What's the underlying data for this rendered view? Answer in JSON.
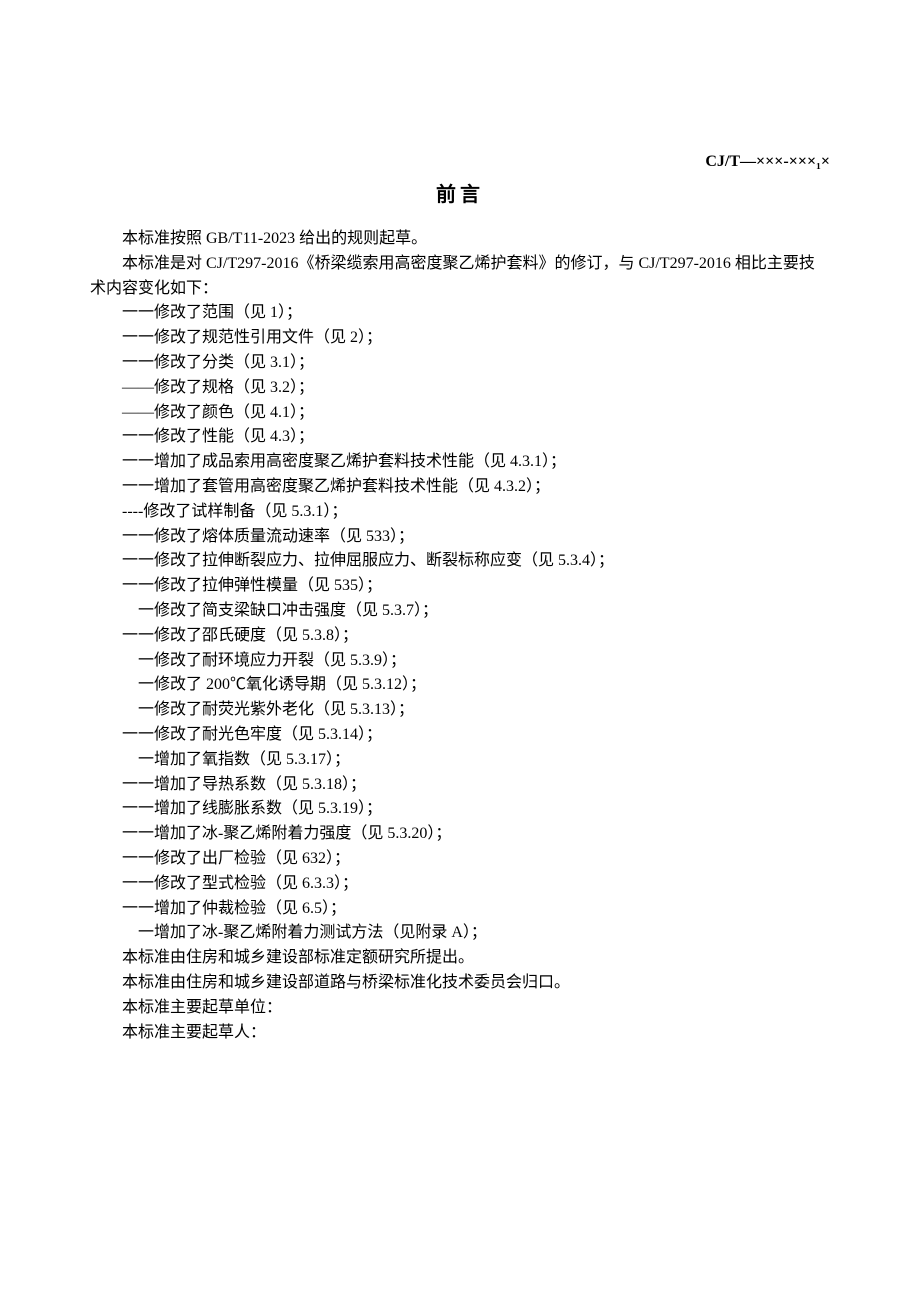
{
  "header_id": "CJ/T—×××-×××₁×",
  "title": "前言",
  "p1": "本标准按照 GB/T11-2023 给出的规则起草。",
  "p2a": "本标准是对 CJ/T297-2016《桥梁缆索用高密度聚乙烯护套料》的修订，与 CJ/T297-2016 相比主要技",
  "p2b": "术内容变化如下：",
  "items": [
    "一一修改了范围（见 1）；",
    "一一修改了规范性引用文件（见 2）；",
    "一一修改了分类（见 3.1）；",
    "——修改了规格（见 3.2）；",
    "——修改了颜色（见 4.1）；",
    "一一修改了性能（见 4.3）；",
    "一一增加了成品索用高密度聚乙烯护套料技术性能（见 4.3.1）；",
    "一一增加了套管用高密度聚乙烯护套料技术性能（见 4.3.2）；",
    "----修改了试样制备（见 5.3.1）；",
    "一一修改了熔体质量流动速率（见 533）；",
    "一一修改了拉伸断裂应力、拉伸屈服应力、断裂标称应变（见 5.3.4）；",
    "一一修改了拉伸弹性模量（见 535）；"
  ],
  "sub1": "一修改了简支梁缺口冲击强度（见 5.3.7）；",
  "items2": [
    "一一修改了邵氏硬度（见 5.3.8）；"
  ],
  "subs2": [
    "一修改了耐环境应力开裂（见 5.3.9）；",
    "一修改了 200℃氧化诱导期（见 5.3.12）；",
    "一修改了耐荧光紫外老化（见 5.3.13）；"
  ],
  "items3": [
    "一一修改了耐光色牢度（见 5.3.14）；"
  ],
  "sub3": "一增加了氧指数（见 5.3.17）；",
  "items4": [
    "一一增加了导热系数（见 5.3.18）；",
    "一一增加了线膨胀系数（见 5.3.19）；",
    "一一增加了冰-聚乙烯附着力强度（见 5.3.20）；",
    "一一修改了出厂检验（见 632）；",
    "一一修改了型式检验（见 6.3.3）；",
    "一一增加了仲裁检验（见 6.5）；"
  ],
  "sub4": "一增加了冰-聚乙烯附着力测试方法（见附录 A）；",
  "tail": [
    "本标准由住房和城乡建设部标准定额研究所提出。",
    "本标准由住房和城乡建设部道路与桥梁标准化技术委员会归口。",
    "本标准主要起草单位：",
    "本标准主要起草人："
  ]
}
